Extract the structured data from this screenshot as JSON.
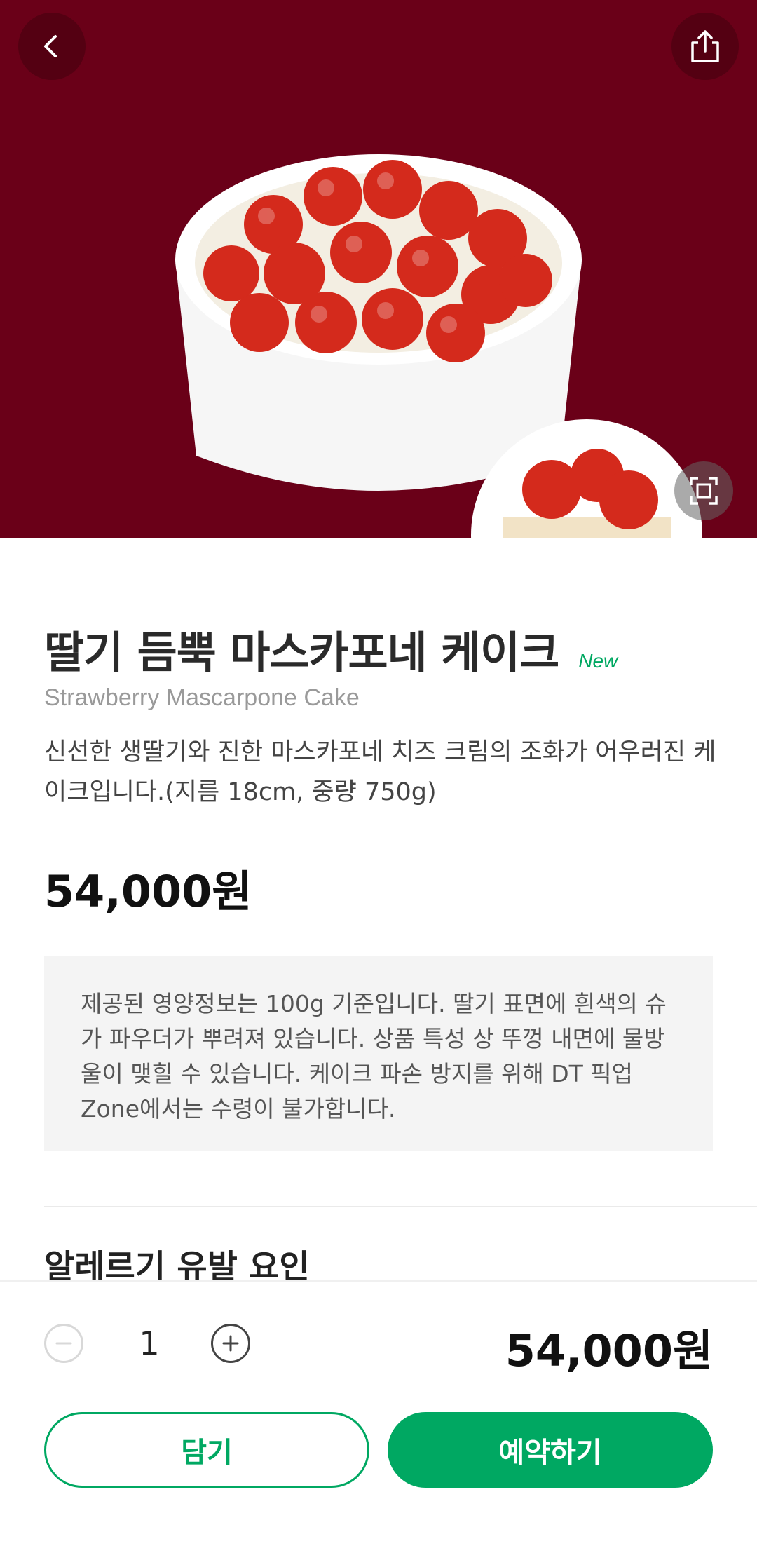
{
  "colors": {
    "hero_background": "#6a0018",
    "accent_green": "#00a862"
  },
  "header": {
    "back_icon": "chevron-left-icon",
    "share_icon": "share-icon",
    "expand_icon": "expand-icon"
  },
  "product": {
    "title": "딸기 듬뿍 마스카포네 케이크",
    "badge": "New",
    "english_name": "Strawberry Mascarpone Cake",
    "description": "신선한 생딸기와 진한 마스카포네 치즈 크림의 조화가 어우러진 케이크입니다.(지름 18cm, 중량 750g)",
    "price": "54,000원"
  },
  "notice": {
    "text": "제공된 영양정보는 100g 기준입니다. 딸기 표면에 흰색의 슈가 파우더가 뿌려져 있습니다. 상품 특성 상 뚜껑 내면에 물방울이 맺힐 수 있습니다. 케이크 파손 방지를 위해 DT 픽업 Zone에서는 수령이 불가합니다."
  },
  "allergy": {
    "title": "알레르기 유발 요인"
  },
  "order": {
    "quantity": "1",
    "total": "54,000원",
    "cart_label": "담기",
    "reserve_label": "예약하기"
  }
}
